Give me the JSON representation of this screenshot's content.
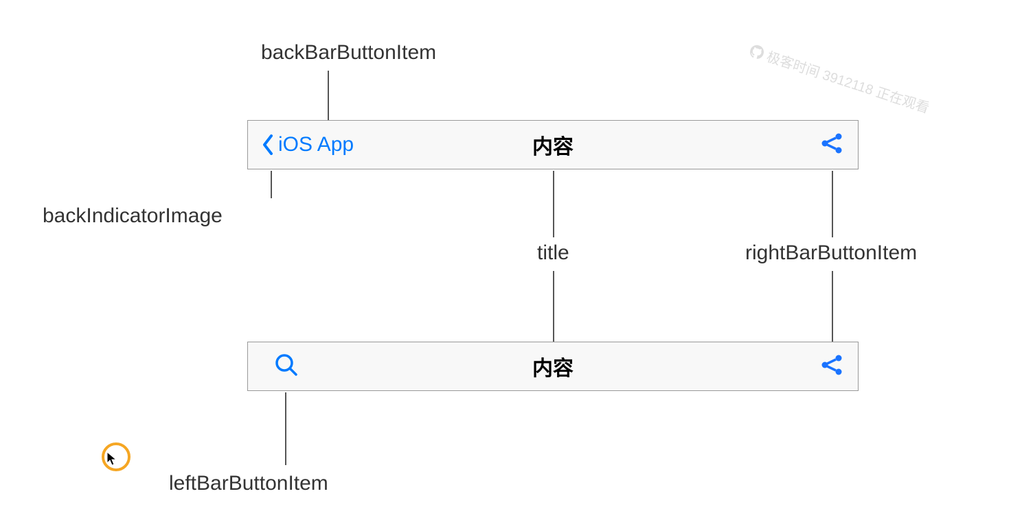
{
  "labels": {
    "backBarButtonItem": "backBarButtonItem",
    "backIndicatorImage": "backIndicatorImage",
    "title": "title",
    "rightBarButtonItem": "rightBarButtonItem",
    "leftBarButtonItem": "leftBarButtonItem"
  },
  "navbar1": {
    "backText": "iOS App",
    "title": "内容"
  },
  "navbar2": {
    "title": "内容"
  },
  "watermark": {
    "text": "极客时间 3912118 正在观看"
  },
  "colors": {
    "ios_blue": "#007aff",
    "share_blue": "#1a73ff",
    "bar_bg": "#f8f8f8",
    "border": "#999999",
    "label_text": "#333333",
    "cursor_ring": "#f5a623"
  }
}
